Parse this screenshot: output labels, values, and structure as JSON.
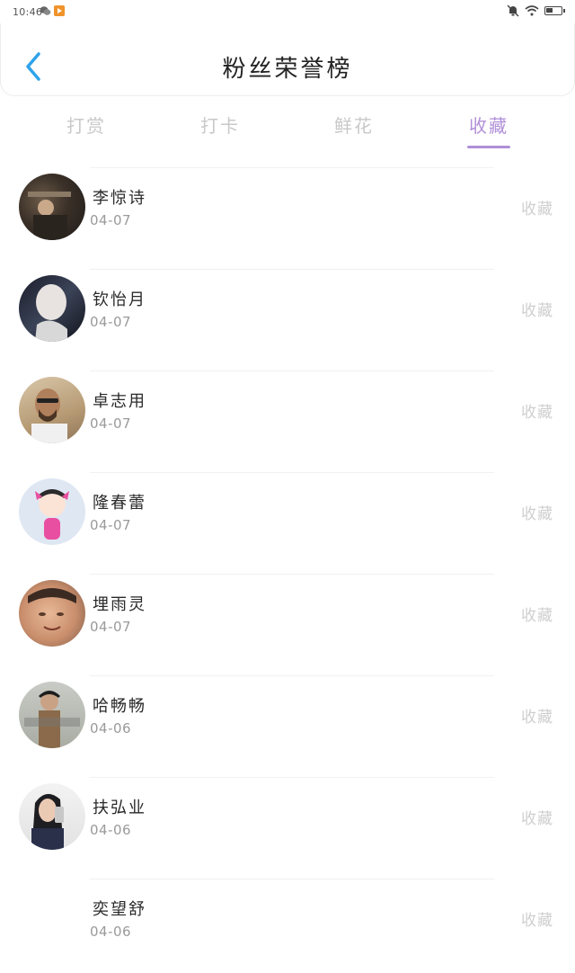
{
  "status_bar": {
    "time": "10:46",
    "icons_left": [
      "wechat-icon",
      "video-app-icon"
    ],
    "icons_right": [
      "mute-bell-icon",
      "wifi-icon",
      "battery-icon"
    ]
  },
  "header": {
    "title": "粉丝荣誉榜",
    "back_icon": "chevron-left-icon",
    "accent": "#2ea3ea"
  },
  "tabs": [
    {
      "label": "打赏",
      "active": false
    },
    {
      "label": "打卡",
      "active": false
    },
    {
      "label": "鲜花",
      "active": false
    },
    {
      "label": "收藏",
      "active": true
    }
  ],
  "active_tab_color": "#b08fd8",
  "fans": [
    {
      "name": "李惊诗",
      "date": "04-07",
      "action": "收藏"
    },
    {
      "name": "钦怡月",
      "date": "04-07",
      "action": "收藏"
    },
    {
      "name": "卓志用",
      "date": "04-07",
      "action": "收藏"
    },
    {
      "name": "隆春蕾",
      "date": "04-07",
      "action": "收藏"
    },
    {
      "name": "埋雨灵",
      "date": "04-07",
      "action": "收藏"
    },
    {
      "name": "哈畅畅",
      "date": "04-06",
      "action": "收藏"
    },
    {
      "name": "扶弘业",
      "date": "04-06",
      "action": "收藏"
    },
    {
      "name": "奕望舒",
      "date": "04-06",
      "action": "收藏"
    }
  ]
}
